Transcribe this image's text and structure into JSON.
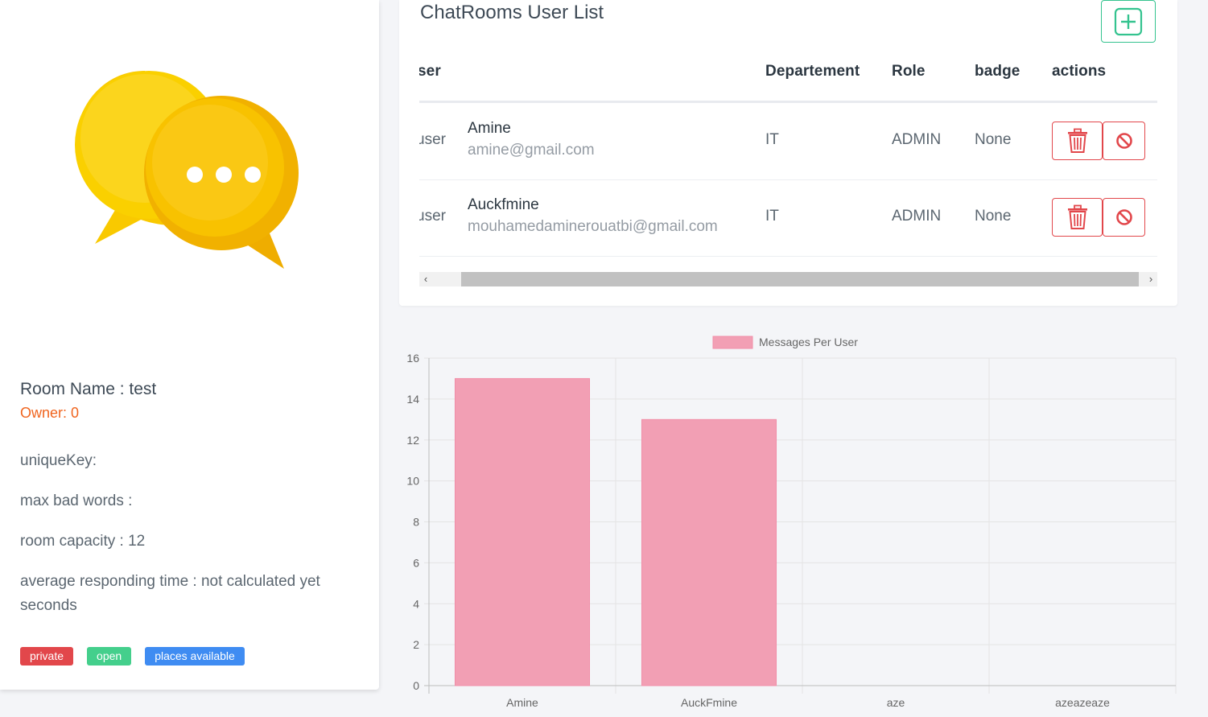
{
  "room": {
    "name": "Room Name : test",
    "owner": "Owner: 0",
    "unique_key": "uniqueKey:",
    "max_bad_words": "max bad words :",
    "capacity": "room capacity : 12",
    "avg_time": "average responding time : not calculated yet seconds",
    "badges": {
      "private": "private",
      "open": "open",
      "places": "places available"
    },
    "logo_icon": "chat-bubbles-icon"
  },
  "user_list": {
    "title": "ChatRooms User List",
    "add_icon": "plus-square-icon",
    "columns": {
      "user": "ser",
      "departement": "Departement",
      "role": "Role",
      "badge": "badge",
      "actions": "actions"
    },
    "rows": [
      {
        "avatar": "user",
        "name": "Amine",
        "email": "amine@gmail.com",
        "departement": "IT",
        "role": "ADMIN",
        "badge": "None"
      },
      {
        "avatar": "user",
        "name": "Auckfmine",
        "email": "mouhamedaminerouatbi@gmail.com",
        "departement": "IT",
        "role": "ADMIN",
        "badge": "None"
      }
    ],
    "scroll_left": "‹",
    "scroll_right": "›"
  },
  "colors": {
    "bar": "#f29fb4",
    "danger": "#e2474b",
    "success": "#34c38f",
    "owner": "#f0641e"
  },
  "chart_data": {
    "type": "bar",
    "categories": [
      "Amine",
      "AuckFmine",
      "aze",
      "azeazeaze"
    ],
    "series": [
      {
        "name": "Messages Per User",
        "values": [
          15,
          13,
          0,
          0
        ]
      }
    ],
    "ylim": [
      0,
      16
    ],
    "yticks": [
      "0",
      "2",
      "4",
      "6",
      "8",
      "10",
      "12",
      "14",
      "16"
    ],
    "grid": true,
    "legend": "top-center"
  }
}
